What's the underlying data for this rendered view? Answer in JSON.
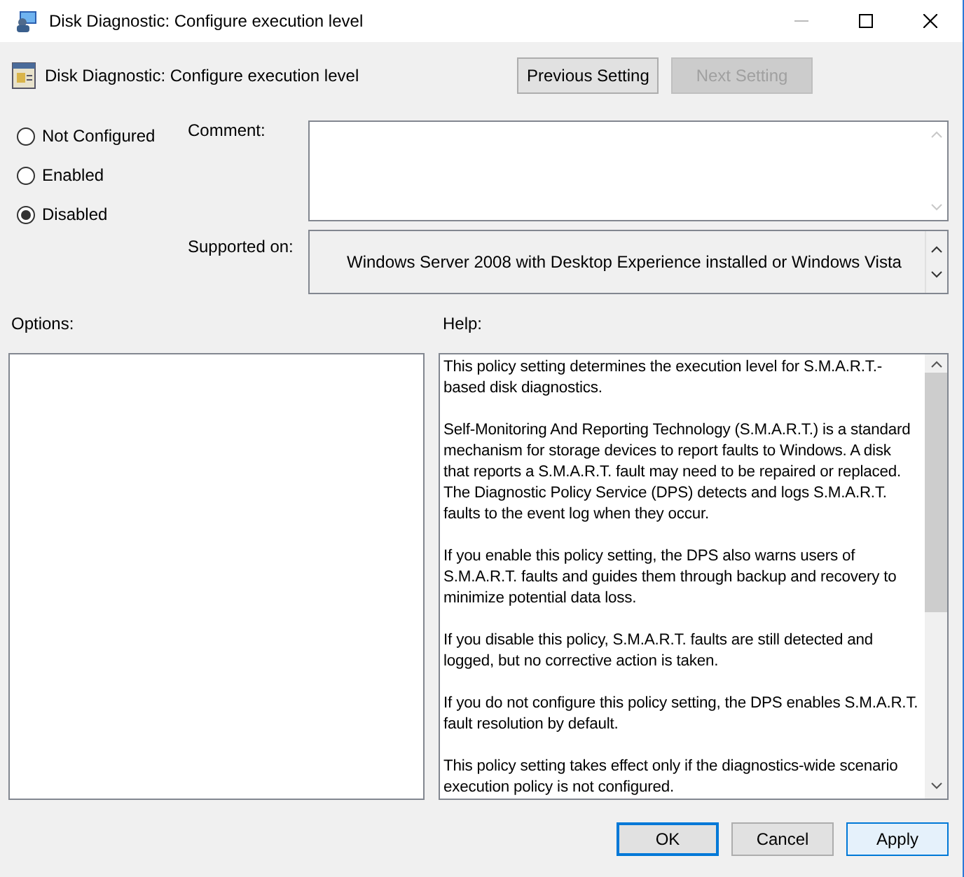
{
  "window": {
    "title": "Disk Diagnostic: Configure execution level"
  },
  "header": {
    "title": "Disk Diagnostic: Configure execution level"
  },
  "nav_buttons": [
    {
      "label": "Previous Setting",
      "disabled": false
    },
    {
      "label": "Next Setting",
      "disabled": true
    }
  ],
  "options": [
    {
      "label": "Not Configured",
      "selected": false
    },
    {
      "label": "Enabled",
      "selected": false
    },
    {
      "label": "Disabled",
      "selected": true
    }
  ],
  "comment": {
    "label": "Comment:"
  },
  "supported_on": {
    "label": "Supported on:",
    "value": "Windows Server 2008 with Desktop Experience installed or Windows Vista"
  },
  "options_pane": {
    "label": "Options:"
  },
  "help_pane": {
    "label": "Help:",
    "paragraphs": [
      "This policy setting determines the execution level for S.M.A.R.T.-based disk diagnostics.",
      "Self-Monitoring And Reporting Technology (S.M.A.R.T.) is a standard mechanism for storage devices to report faults to Windows. A disk that reports a S.M.A.R.T. fault may need to be repaired or replaced. The Diagnostic Policy Service (DPS) detects and logs S.M.A.R.T. faults to the event log when they occur.",
      "If you enable this policy setting, the DPS also warns users of S.M.A.R.T. faults and guides them through backup and recovery to minimize potential data loss.",
      "If you disable this policy, S.M.A.R.T. faults are still detected and logged, but no corrective action is taken.",
      "If you do not configure this policy setting, the DPS enables S.M.A.R.T. fault resolution by default.",
      "This policy setting takes effect only if the diagnostics-wide scenario execution policy is not configured."
    ]
  },
  "footer_buttons": [
    {
      "label": "OK",
      "kind": "default"
    },
    {
      "label": "Cancel",
      "kind": "normal"
    },
    {
      "label": "Apply",
      "kind": "hover"
    }
  ]
}
